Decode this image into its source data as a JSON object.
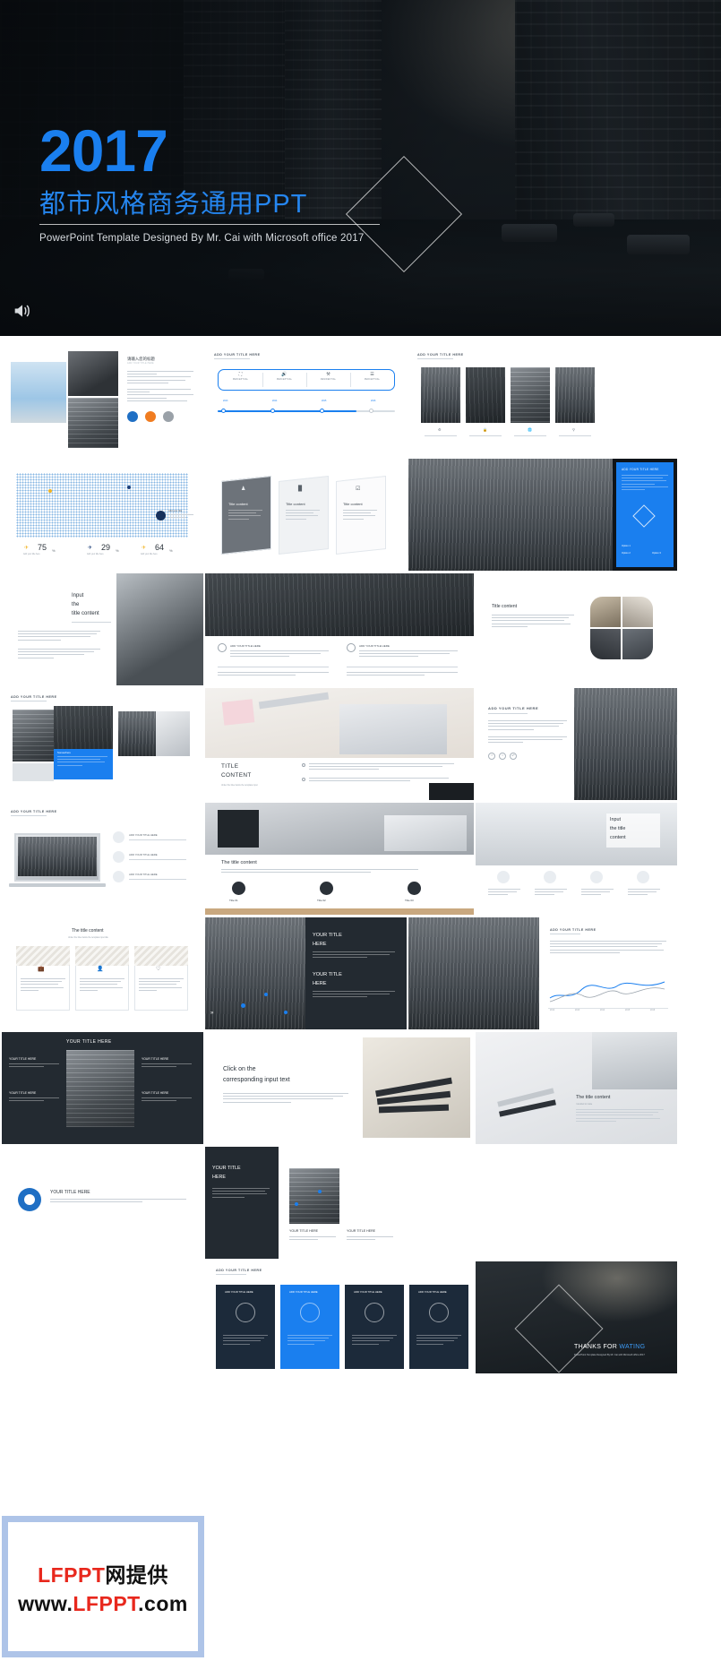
{
  "hero": {
    "year": "2017",
    "title_cn": "都市风格商务通用PPT",
    "tagline": "PowerPoint Template Designed By Mr. Cai with Microsoft office 2017",
    "accent": "#1a7fef",
    "speaker_icon": "speaker-icon"
  },
  "common": {
    "title_here": "ADD YOUR TITLE HERE",
    "your_title_here": "YOUR TITLE HERE",
    "the_title_content": "The title content",
    "title_content": "Title content",
    "add_your_title_here": "ADD YOUR TITLE HERE",
    "sub_placeholder": "Add your title here text",
    "lorem": "Lorem ipsum dolor sit amet, consectetur adipisicing elit, sed do eiusmod tempor incididunt ut labore et dolore magna aliqua. Ut enim ad minim veniam, quis nostrud exercitation ullamco laboris nisi ut aliquip ex commodo consequat.",
    "welcome": "We welcome your play world network of sites put",
    "compete": "To compete in the challenging global environment, companies are changing their business"
  },
  "slides": [
    {
      "id": "s1",
      "name": "photo-collage-intro",
      "title_cn": "请输入您的标题",
      "title_en": "ADD YOUR TITLE HERE",
      "icons": [
        "globe-icon",
        "trend-chart-icon",
        "wrench-icon"
      ],
      "icon_colors": [
        "#1f6fc4",
        "#f07c20",
        "#9aa1a8"
      ]
    },
    {
      "id": "s2",
      "name": "tab-bar-and-slider",
      "header": "ADD YOUR TITLE HERE",
      "tabs": [
        {
          "icon": "camera-icon",
          "label": "PERCEPTUAL"
        },
        {
          "icon": "megaphone-icon",
          "label": "PERCEPTUAL"
        },
        {
          "icon": "hierarchy-icon",
          "label": "RESIDENTIAL"
        },
        {
          "icon": "document-icon",
          "label": "PERCEPTUAL"
        }
      ],
      "steps": [
        "2013",
        "2014",
        "2015",
        "2016"
      ],
      "progress_percent": 78
    },
    {
      "id": "s3",
      "name": "four-photo-cards",
      "header": "ADD YOUR TITLE HERE",
      "cards": [
        {
          "icon": "gear-icon"
        },
        {
          "icon": "lock-icon"
        },
        {
          "icon": "globe-icon"
        },
        {
          "icon": "pin-icon"
        }
      ]
    },
    {
      "id": "s4",
      "name": "world-map-stats",
      "callout_title": "Add your title",
      "stats": [
        {
          "icon": "plane-icon",
          "color": "#f2b423",
          "value": "75",
          "unit": "%",
          "label": "Add your title here"
        },
        {
          "icon": "plane-icon",
          "color": "#1d3f7a",
          "value": "29",
          "unit": "%",
          "label": "Add your title here"
        },
        {
          "icon": "plane-icon",
          "color": "#f2b423",
          "value": "64",
          "unit": "%",
          "label": "Add your title here"
        }
      ]
    },
    {
      "id": "s5",
      "name": "three-skewed-cards",
      "cards": [
        {
          "icon": "user-icon",
          "title": "Title content"
        },
        {
          "icon": "bar-chart-icon",
          "title": "Title content"
        },
        {
          "icon": "checklist-icon",
          "title": "Title content"
        }
      ]
    },
    {
      "id": "s6",
      "name": "street-photo-blue-panel",
      "panel_title": "ADD YOUR TITLE HERE",
      "diamond_icon": "diamond-icon",
      "options": [
        "Option 1",
        "Option 2",
        "Option 3"
      ]
    },
    {
      "id": "s7",
      "name": "input-the-title-content",
      "title_line1": "Input",
      "title_line2": "the",
      "title_line3": "title content",
      "body": "I decided to make a list of some of my favorite sites for  free stock photos.   If you haven`t heard the  public domain images  you were looking for at Public Domain Archive.",
      "body2": "Although you  re more than welcome to for  free stock photos.   If you haven`t heard the  public domain images  and videos you can use anywhere. All images and videos."
    },
    {
      "id": "s8",
      "name": "two-column-street-photos",
      "blocks": [
        {
          "title": "ADD YOUR TITLE HERE"
        },
        {
          "title": "ADD YOUR TITLE HERE"
        }
      ]
    },
    {
      "id": "s9",
      "name": "title-content-circle-photos",
      "title": "Title content",
      "body": "Although you`  re more than welcome to be use  can images for a website. Free images and videos you can use anywhere. I hate buying stock photos just to use them once."
    },
    {
      "id": "s10",
      "name": "photo-stack-overlay",
      "header": "ADD YOUR TITLE HERE",
      "badge": "Somewhere"
    },
    {
      "id": "s11",
      "name": "desk-photo-title-content",
      "title_line1": "TITLE",
      "title_line2": "CONTENT",
      "caption": "Under the blue below the template input",
      "body": "I decided to make a list of some of my favorite sites for  free stock photos.   If you haven`t heard the  public domain images  you were looking for at Public Domain Archive.",
      "body2": "If you haven`t heard the  public domain images  you were looking for at Public Domain Archive."
    },
    {
      "id": "s12",
      "name": "add-your-title-here-text",
      "header": "ADD YOUR TITLE HERE",
      "social_icons": [
        "facebook-icon",
        "twitter-icon",
        "link-icon"
      ]
    },
    {
      "id": "s13",
      "name": "street-photo-right",
      "header": ""
    },
    {
      "id": "s14",
      "name": "laptop-mockup-list",
      "header": "ADD YOUR TITLE HERE",
      "items": [
        {
          "icon": "pencil-icon",
          "label": "ADD YOUR TITLE HERE"
        },
        {
          "icon": "edit-icon",
          "label": "ADD YOUR TITLE HERE"
        },
        {
          "icon": "chart-icon",
          "label": "ADD YOUR TITLE HERE"
        }
      ]
    },
    {
      "id": "s15",
      "name": "notebook-photo-three-steps",
      "title": "The title content",
      "subtitle": "As a web designer, I am always looking for awesome photos to include in my designs and mockups. I hate buying stock photos just to use them once.",
      "steps": [
        {
          "icon": "clock-icon",
          "label": "Title 01"
        },
        {
          "icon": "rocket-icon",
          "label": "Title 02"
        },
        {
          "icon": "tool-icon",
          "label": "Title 03"
        }
      ]
    },
    {
      "id": "s16",
      "name": "input-the-title-content-2",
      "title_line1": "Input",
      "title_line2": "the title",
      "title_line3": "content",
      "items": [
        {
          "icon": "laptop-icon",
          "text": "Although you`  re more than welcome to for  free stock photos."
        },
        {
          "icon": "camera-icon",
          "text": "Free images and videos you can use anywhere. All images and videos."
        },
        {
          "icon": "headphone-icon",
          "text": "Under the blue below the template input title."
        },
        {
          "icon": "phone-icon",
          "text": "you were looking for at public domain archives."
        }
      ]
    },
    {
      "id": "s17",
      "name": "three-icon-cards",
      "title": "The title content",
      "subtitle": "Under the blue below the template input title",
      "cards": [
        {
          "icon": "briefcase-icon",
          "text": "Free images and videos you can use anywhere. All images and videos for Pixabay."
        },
        {
          "icon": "person-icon",
          "text": "If you haven`t heard the  public domain images  you were looking for a website."
        },
        {
          "icon": "heart-icon",
          "text": "I hate buying stock photos just to use them once. Free images and videos."
        }
      ]
    },
    {
      "id": "s18",
      "name": "your-title-here-dark-split",
      "title_line1": "YOUR TITLE",
      "title_line2": "HERE",
      "body": "We welcome your play world network of sites put brand formed their valuable opinions or suggestions web products and services",
      "arrow": "chevron-right-icon"
    },
    {
      "id": "s19",
      "name": "your-title-here-two-blocks",
      "blocks": [
        {
          "title": "YOUR TITLE HERE",
          "body": "We welcome your play world network of sites put brand formed their valuable opinions or suggestions web products and services"
        },
        {
          "title": "YOUR TITLE HERE",
          "body": "We welcome your play world network of sites put brand formed their valuable opinions or suggestions web products and services"
        }
      ]
    },
    {
      "id": "s20",
      "name": "line-chart-slide",
      "header": "ADD YOUR TITLE HERE",
      "body": "To compete in the challenging global environment, companies are changing their business processes and organizational structure to be able to get better at what companies in the supply chain. They are also changing the way they evaluate performance to reflect the competitive realities of the supply chain.",
      "xticks": [
        "2012",
        "2013",
        "2014",
        "2015",
        "2016"
      ]
    },
    {
      "id": "s21",
      "name": "four-title-grid-dark",
      "header": "YOUR TITLE HERE",
      "cells": [
        {
          "title": "YOUR TITLE HERE",
          "body": "We welcome your play world network of sites put"
        },
        {
          "title": "YOUR TITLE HERE",
          "body": "We welcome your play world network of sites put"
        },
        {
          "title": "YOUR TITLE HERE",
          "body": "We welcome your play world network of sites put"
        },
        {
          "title": "YOUR TITLE HERE",
          "body": "We welcome your play world network of sites put"
        }
      ]
    },
    {
      "id": "s22",
      "name": "click-on-corresponding-input",
      "title_line1": "Click on the",
      "title_line2": "corresponding input text",
      "body": "Although you`  re more than welcome to for  free stock photos.   If you haven`t heard the  public domain images  you were looking for at public domain archives. Free images and videos you can use anywhere."
    },
    {
      "id": "s23",
      "name": "the-title-content-pens",
      "title": "The title content",
      "subtitle": "I decided to make",
      "body": "A list of some of my favorite sites for  free stock photos.   If you haven`t heard the  public domain images  you were looking for at Public Domain Archive. Free images and videos you can use anywhere. All images and videos on Pixabay."
    },
    {
      "id": "s24",
      "name": "circle-avatar-title-row",
      "icon": "person-badge-icon",
      "title": "YOUR TITLE HERE",
      "body": "We welcome your play world network of sites put !!! We welcome your play world network of sites put ?! welcome your play world network of sites put network of sites put"
    },
    {
      "id": "s25",
      "name": "your-title-here-dark-left",
      "title_line1": "YOUR TITLE",
      "title_line2": "HERE",
      "body": "We welcome your play world network of sites put brand formed their valuable opinions or suggestions web products and services"
    },
    {
      "id": "s26",
      "name": "two-photo-titles",
      "blocks": [
        {
          "title": "YOUR TITLE HERE",
          "body": "We welcome your play world network of sites put"
        },
        {
          "title": "YOUR TITLE HERE",
          "body": "We welcome your play world network of sites put"
        }
      ]
    },
    {
      "id": "s27",
      "name": "four-navy-cards",
      "header": "ADD YOUR TITLE HERE",
      "cards": [
        {
          "title": "ADD YOUR TITLE HERE",
          "icon": "camera-icon",
          "body": "To compete in the challenging global environment, companies are changing their business processes",
          "active": false
        },
        {
          "title": "ADD YOUR TITLE HERE",
          "icon": "megaphone-icon",
          "body": "To compete in the challenging global environment, companies are changing their business processes",
          "active": true
        },
        {
          "title": "ADD YOUR TITLE HERE",
          "icon": "hierarchy-icon",
          "body": "To compete in the challenging global environment, companies are changing their business processes",
          "active": false
        },
        {
          "title": "ADD YOUR TITLE HERE",
          "icon": "monitor-icon",
          "body": "To compete in the challenging global environment, companies are changing their business processes",
          "active": false
        }
      ]
    },
    {
      "id": "s28",
      "name": "thanks-slide",
      "thanks_prefix": "THANKS FOR ",
      "thanks_accent": "WATING",
      "tagline": "PowerPoint Template Designed By Mr. Cai with Microsoft office 2017"
    }
  ],
  "promo": {
    "line1_red": "LFPPT",
    "line1_black": "网提供",
    "line2_pre": "www.",
    "line2_red": "LFPPT",
    "line2_post": ".com",
    "border_color": "#aec4e8",
    "red": "#e8281d"
  }
}
